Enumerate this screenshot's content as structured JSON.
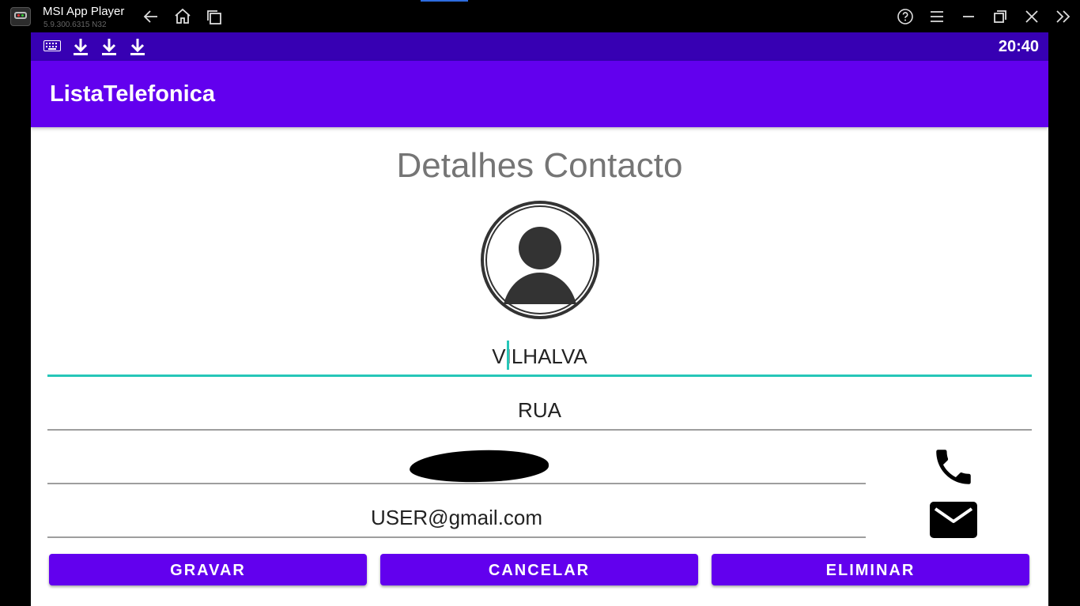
{
  "window": {
    "app_name": "MSI App Player",
    "version": "5.9.300.6315  N32"
  },
  "status_bar": {
    "time": "20:40",
    "icons": [
      "keyboard-icon",
      "download-icon",
      "download-icon",
      "download-icon"
    ]
  },
  "app_bar": {
    "title": "ListaTelefonica"
  },
  "form": {
    "title": "Detalhes Contacto",
    "name_value": "VILHALVA",
    "address_value": "RUA",
    "phone_value": "",
    "email_value": "USER@gmail.com"
  },
  "buttons": {
    "save_label": "GRAVAR",
    "cancel_label": "CANCELAR",
    "delete_label": "ELIMINAR"
  },
  "colors": {
    "status_bar": "#3700b3",
    "primary": "#6200ee",
    "accent": "#26c6b8",
    "title_gray": "#757575"
  }
}
